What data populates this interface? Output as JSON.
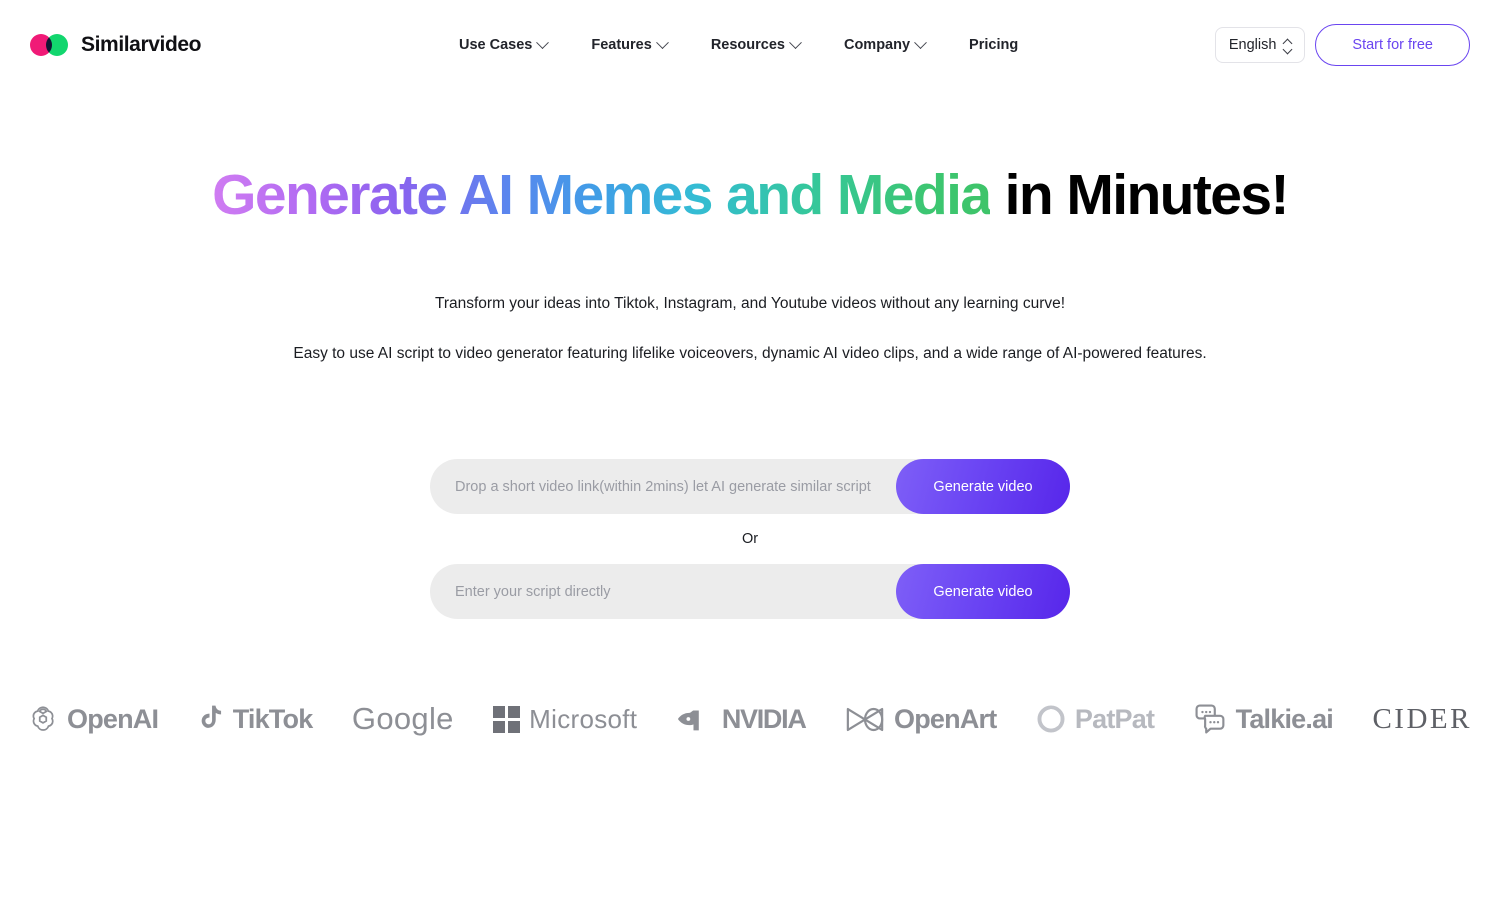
{
  "brand": {
    "name": "Similarvideo",
    "logo_icon": "two-overlapping-circles-logo",
    "color_left": "#f01a77",
    "color_right": "#12d66e"
  },
  "nav": {
    "items": [
      {
        "label": "Use Cases",
        "has_chevron": true,
        "icon": "chevron-down-icon"
      },
      {
        "label": "Features",
        "has_chevron": true,
        "icon": "chevron-down-icon"
      },
      {
        "label": "Resources",
        "has_chevron": true,
        "icon": "chevron-down-icon"
      },
      {
        "label": "Company",
        "has_chevron": true,
        "icon": "chevron-down-icon"
      },
      {
        "label": "Pricing",
        "has_chevron": false,
        "icon": ""
      }
    ]
  },
  "header_right": {
    "language_value": "English",
    "language_icon": "chevron-up-down-icon",
    "cta_label": "Start for free",
    "cta_color": "#6a45f0"
  },
  "hero": {
    "headline_gradient": "Generate AI Memes and Media",
    "headline_plain": " in Minutes!",
    "gradient_start": "#d07cf2",
    "gradient_end": "#3ec469",
    "subtitle_1": "Transform your ideas into Tiktok, Instagram, and Youtube videos without any learning curve!",
    "subtitle_2": "Easy to use AI script to video generator featuring lifelike voiceovers, dynamic AI video clips, and a wide range of AI-powered features."
  },
  "generator": {
    "link_placeholder": "Drop a short video link(within 2mins) let AI generate similar script",
    "link_value": "",
    "link_button_label": "Generate video",
    "divider_label": "Or",
    "script_placeholder": "Enter your script directly",
    "script_value": "",
    "script_button_label": "Generate video",
    "button_gradient_start": "#7e5ff7",
    "button_gradient_end": "#5726ea"
  },
  "partners": [
    {
      "name": "OpenAI",
      "icon": "openai-flower-icon"
    },
    {
      "name": "TikTok",
      "icon": "tiktok-note-icon"
    },
    {
      "name": "Google",
      "icon": ""
    },
    {
      "name": "Microsoft",
      "icon": "microsoft-grid-icon"
    },
    {
      "name": "NVIDIA",
      "icon": "nvidia-eye-icon"
    },
    {
      "name": "OpenArt",
      "icon": "openart-bowtie-icon"
    },
    {
      "name": "PatPat",
      "icon": "patpat-circle-icon"
    },
    {
      "name": "Talkie.ai",
      "icon": "talkie-chat-bubbles-icon"
    },
    {
      "name": "CIDER",
      "icon": ""
    }
  ]
}
